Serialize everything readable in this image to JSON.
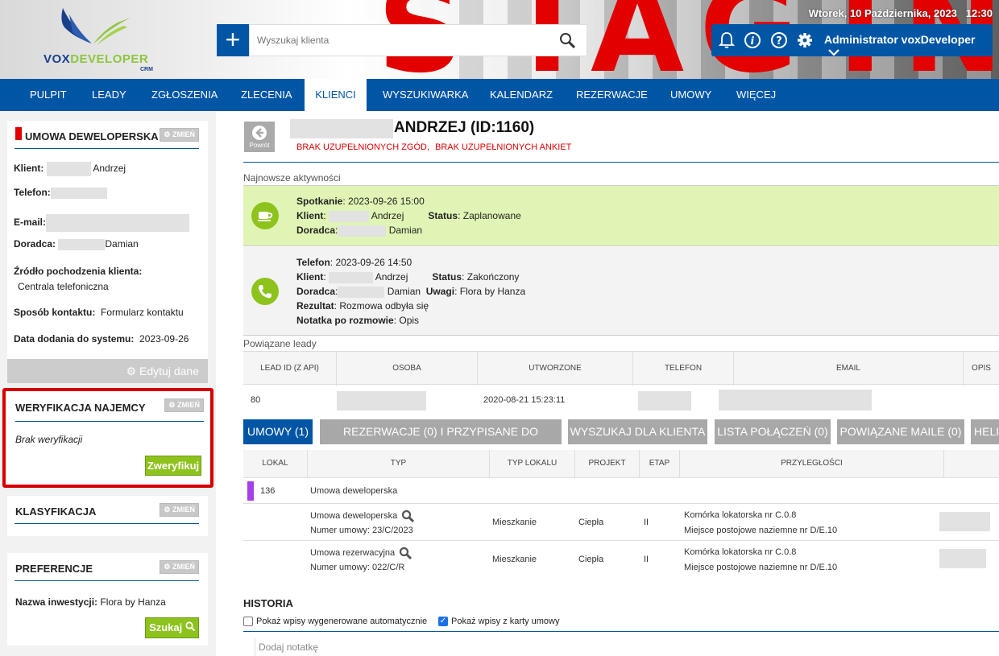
{
  "header": {
    "datetime": "Wtorek, 10 Października, 2023   12:30",
    "search_placeholder": "Wyszukaj klienta",
    "user": "Administrator voxDeveloper",
    "stage_text": "STAGIN",
    "logo": {
      "main": "VOXDEVELOPER",
      "crm": "CRM"
    }
  },
  "nav": [
    "PULPIT",
    "LEADY",
    "ZGŁOSZENIA",
    "ZLECENIA",
    "KLIENCI",
    "WYSZUKIWARKA",
    "KALENDARZ",
    "REZERWACJE",
    "UMOWY",
    "WIĘCEJ"
  ],
  "left": {
    "contract": {
      "title": "UMOWA DEWELOPERSKA",
      "change": "ZMIEŃ",
      "client_label": "Klient:",
      "client_value": "Andrzej",
      "phone_label": "Telefon:",
      "email_label": "E-mail:",
      "advisor_label": "Doradca:",
      "advisor_value": "Damian",
      "source_label": "Źródło pochodzenia klienta:",
      "source_value": "Centrala telefoniczna",
      "contact_label": "Sposób kontaktu:",
      "contact_value": "Formularz kontaktu",
      "added_label": "Data dodania do systemu:",
      "added_value": "2023-09-26",
      "edit": "Edytuj dane"
    },
    "verify": {
      "title": "WERYFIKACJA NAJEMCY",
      "change": "ZMIEŃ",
      "status": "Brak weryfikacji",
      "button": "Zweryfikuj"
    },
    "classification": {
      "title": "KLASYFIKACJA",
      "change": "ZMIEŃ"
    },
    "preferences": {
      "title": "PREFERENCJE",
      "change": "ZMIEŃ",
      "invest_label": "Nazwa inwestycji:",
      "invest_value": "Flora by Hanza",
      "search_btn": "Szukaj"
    }
  },
  "client": {
    "back": "Powrót",
    "name": "ANDRZEJ (ID:1160)",
    "warn1": "BRAK UZUPEŁNIONYCH ZGÓD,",
    "warn2": "BRAK UZUPEŁNIONYCH ANKIET"
  },
  "activities": {
    "title": "Najnowsze aktywności",
    "meeting": {
      "type_label": "Spotkanie",
      "date": "2023-09-26 15:00",
      "client_label": "Klient",
      "client": "Andrzej",
      "status_label": "Status",
      "status": "Zaplanowane",
      "advisor_label": "Doradca",
      "advisor": "Damian"
    },
    "call": {
      "type_label": "Telefon",
      "date": "2023-09-26 14:50",
      "client_label": "Klient",
      "client": "Andrzej",
      "status_label": "Status",
      "status": "Zakończony",
      "advisor_label": "Doradca",
      "advisor": "Damian",
      "notes_label": "Uwagi",
      "notes": "Flora by Hanza",
      "result_label": "Rezultat",
      "result": "Rozmowa odbyła się",
      "note_label": "Notatka po rozmowie",
      "note": "Opis"
    }
  },
  "leads": {
    "title": "Powiązane leady",
    "headers": [
      "LEAD ID (Z API)",
      "OSOBA",
      "UTWORZONE",
      "TELEFON",
      "EMAIL",
      "OPIS"
    ],
    "rows": [
      {
        "id": "80",
        "created": "2020-08-21 15:23:11"
      }
    ]
  },
  "tabs": [
    "UMOWY (1)",
    "REZERWACJE (0) I PRZYPISANE DO KLIENTA",
    "WYSZUKAJ DLA KLIENTA",
    "LISTA POŁĄCZEŃ (0)",
    "POWIĄZANE MAILE (0)",
    "HELI"
  ],
  "contracts": {
    "headers": [
      "LOKAL",
      "TYP",
      "TYP LOKALU",
      "PROJEKT",
      "ETAP",
      "PRZYLEGŁOŚCI"
    ],
    "group": {
      "lokal": "136",
      "type": "Umowa deweloperska"
    },
    "rows": [
      {
        "type": "Umowa deweloperska",
        "number": "Numer umowy: 23/C/2023",
        "unit_type": "Mieszkanie",
        "project": "Ciepła",
        "stage": "II",
        "adj1": "Komórka lokatorska nr C.0.8",
        "adj2": "Miejsce postojowe naziemne nr D/E.10"
      },
      {
        "type": "Umowa rezerwacyjna",
        "number": "Numer umowy: 022/C/R",
        "unit_type": "Mieszkanie",
        "project": "Ciepła",
        "stage": "II",
        "adj1": "Komórka lokatorska nr C.0.8",
        "adj2": "Miejsce postojowe naziemne nr D/E.10"
      }
    ]
  },
  "history": {
    "title": "HISTORIA",
    "auto": "Pokaż wpisy wygenerowane automatycznie",
    "contract": "Pokaż wpisy z karty umowy",
    "note_placeholder": "Dodaj notatkę"
  },
  "colors": {
    "blue": "#0055a5",
    "green": "#8dc31c",
    "red": "#e20000",
    "meeting_bg": "#e0f5b5"
  }
}
